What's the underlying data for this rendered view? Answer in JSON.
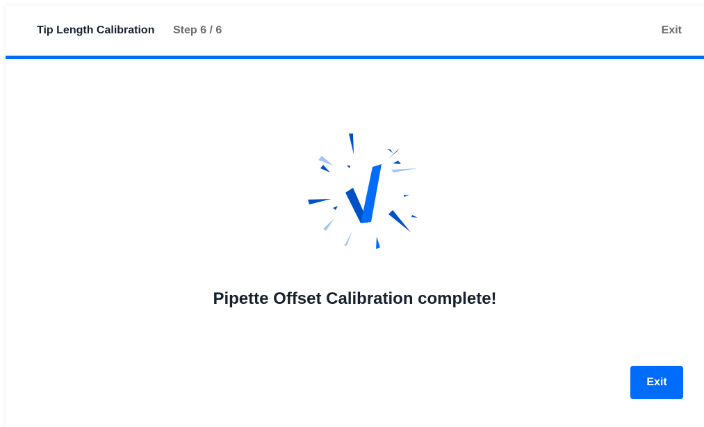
{
  "header": {
    "title": "Tip Length Calibration",
    "step": "Step 6 / 6",
    "exit_label": "Exit"
  },
  "progress": {
    "current_step": 6,
    "total_steps": 6,
    "fraction": 1.0,
    "color": "#006cfa"
  },
  "success": {
    "icon": "checkmark-burst-icon",
    "message": "Pipette Offset Calibration complete!"
  },
  "footer": {
    "exit_button_label": "Exit"
  },
  "colors": {
    "accent": "#006cfa",
    "accent_dark": "#0051c5",
    "accent_light": "#a5c3f5",
    "text_primary": "#16212d",
    "text_secondary": "#6b6b6b"
  }
}
